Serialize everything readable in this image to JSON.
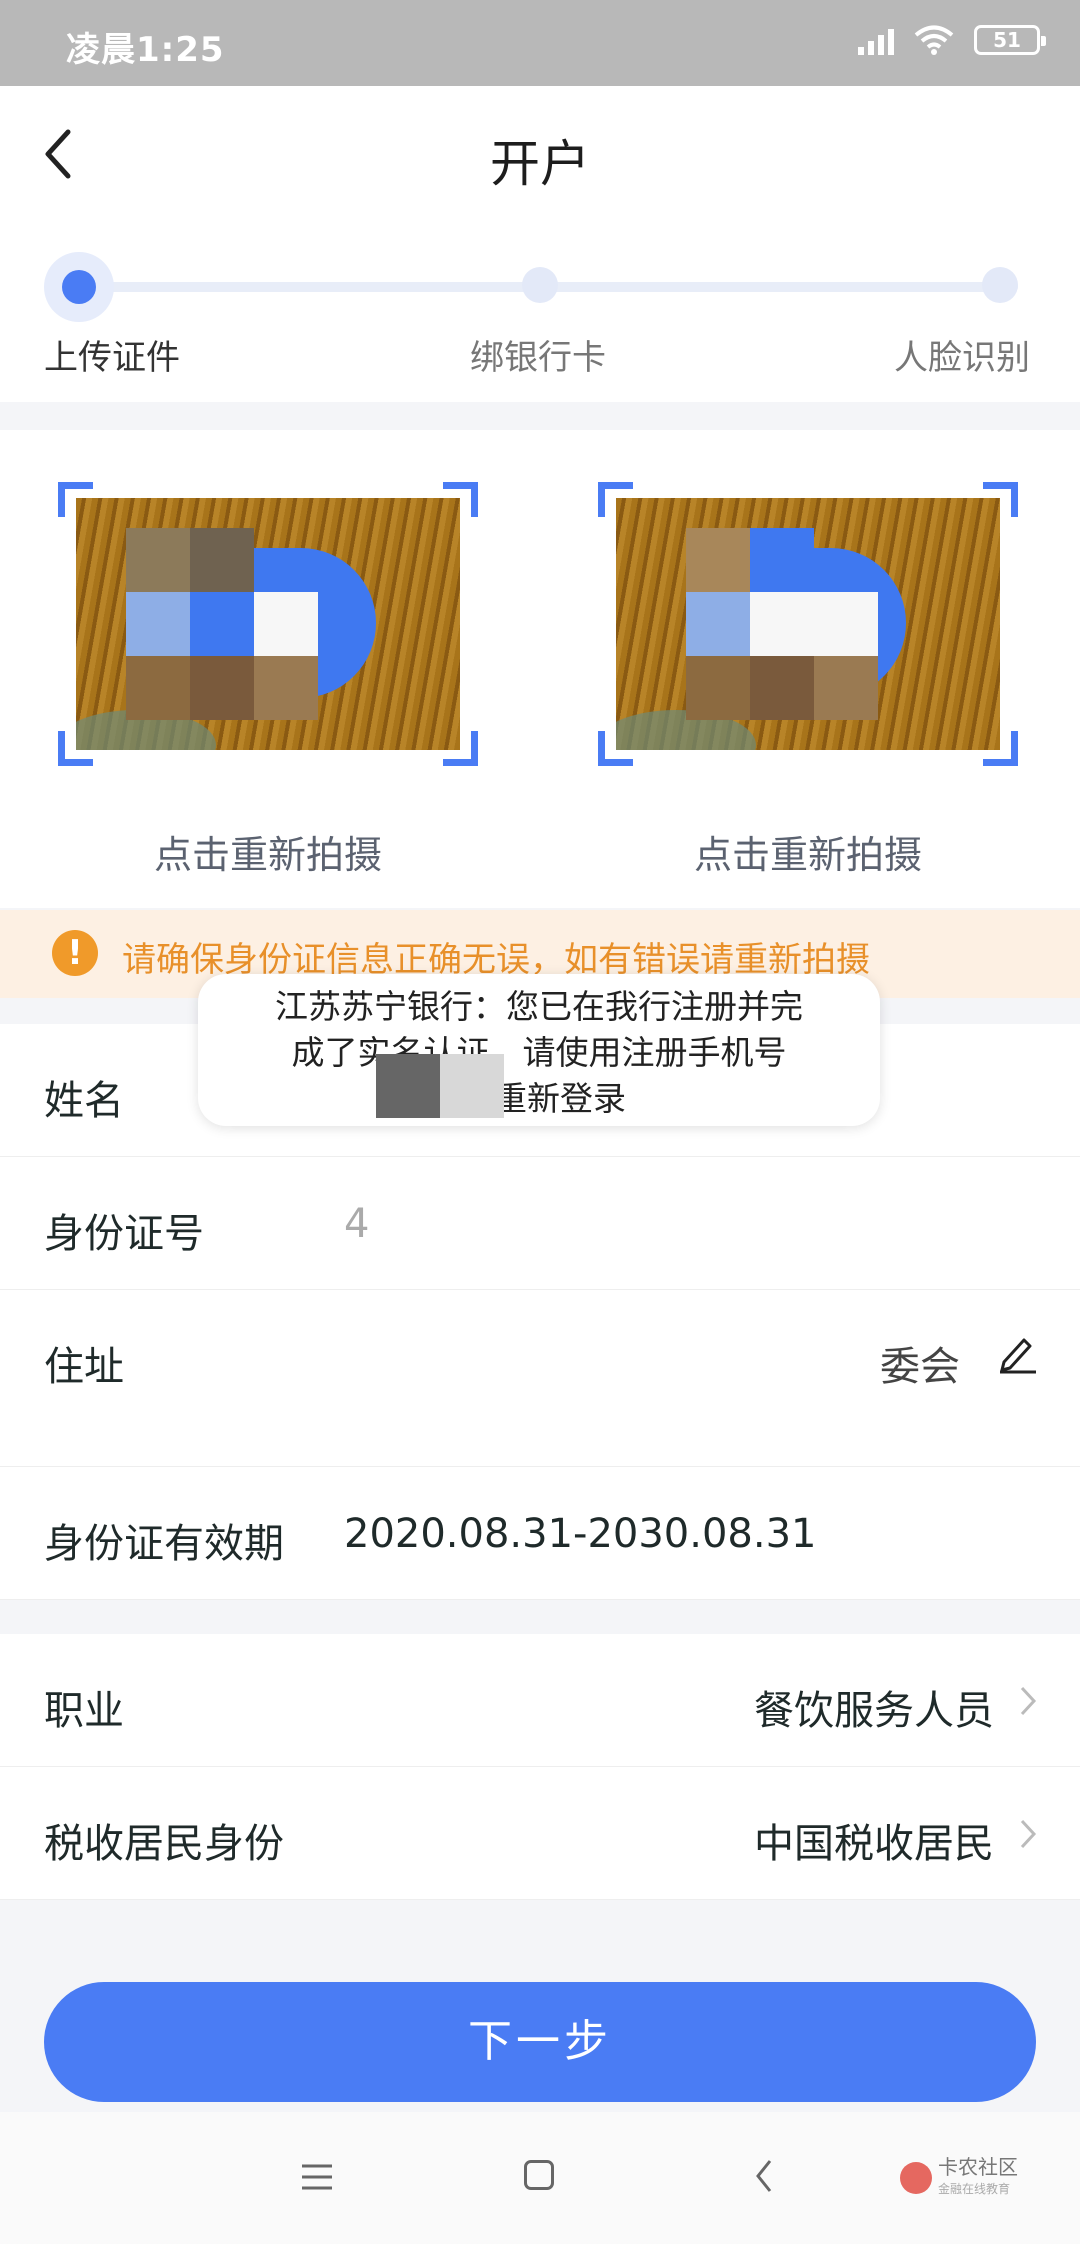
{
  "status_bar": {
    "time": "凌晨1:25",
    "battery": "51"
  },
  "header": {
    "title": "开户"
  },
  "steps": [
    {
      "label": "上传证件",
      "active": true
    },
    {
      "label": "绑银行卡",
      "active": false
    },
    {
      "label": "人脸识别",
      "active": false
    }
  ],
  "photos": {
    "retake_label_front": "点击重新拍摄",
    "retake_label_back": "点击重新拍摄"
  },
  "warning": {
    "text": "请确保身份证信息正确无误，如有错误请重新拍摄"
  },
  "form": {
    "name": {
      "label": "姓名",
      "value": ""
    },
    "id_number": {
      "label": "身份证号",
      "value": "4"
    },
    "address": {
      "label": "住址",
      "value": "委会"
    },
    "validity": {
      "label": "身份证有效期",
      "value": "2020.08.31-2030.08.31"
    },
    "occupation": {
      "label": "职业",
      "value": "餐饮服务人员"
    },
    "tax_residency": {
      "label": "税收居民身份",
      "value": "中国税收居民"
    }
  },
  "toast": {
    "line1": "江苏苏宁银行：您已在我行注册并完",
    "line2": "成了实名认证，请使用注册手机号",
    "line3": "54重新登录"
  },
  "next_button": {
    "label": "下一步"
  },
  "watermark": {
    "name": "卡农社区",
    "sub": "金融在线教育"
  },
  "colors": {
    "accent": "#4a7cf4",
    "warning": "#f09a2a",
    "warning_bg": "#fdf0e3"
  }
}
